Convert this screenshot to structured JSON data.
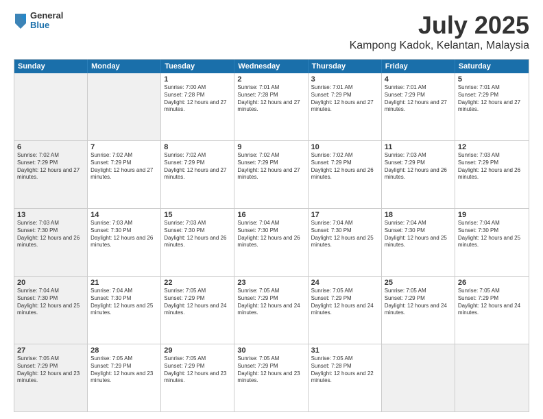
{
  "logo": {
    "general": "General",
    "blue": "Blue"
  },
  "title": "July 2025",
  "subtitle": "Kampong Kadok, Kelantan, Malaysia",
  "header_days": [
    "Sunday",
    "Monday",
    "Tuesday",
    "Wednesday",
    "Thursday",
    "Friday",
    "Saturday"
  ],
  "rows": [
    [
      {
        "day": "",
        "text": "",
        "shaded": true
      },
      {
        "day": "",
        "text": "",
        "shaded": true
      },
      {
        "day": "1",
        "text": "Sunrise: 7:00 AM\nSunset: 7:28 PM\nDaylight: 12 hours and 27 minutes.",
        "shaded": false
      },
      {
        "day": "2",
        "text": "Sunrise: 7:01 AM\nSunset: 7:28 PM\nDaylight: 12 hours and 27 minutes.",
        "shaded": false
      },
      {
        "day": "3",
        "text": "Sunrise: 7:01 AM\nSunset: 7:29 PM\nDaylight: 12 hours and 27 minutes.",
        "shaded": false
      },
      {
        "day": "4",
        "text": "Sunrise: 7:01 AM\nSunset: 7:29 PM\nDaylight: 12 hours and 27 minutes.",
        "shaded": false
      },
      {
        "day": "5",
        "text": "Sunrise: 7:01 AM\nSunset: 7:29 PM\nDaylight: 12 hours and 27 minutes.",
        "shaded": false
      }
    ],
    [
      {
        "day": "6",
        "text": "Sunrise: 7:02 AM\nSunset: 7:29 PM\nDaylight: 12 hours and 27 minutes.",
        "shaded": true
      },
      {
        "day": "7",
        "text": "Sunrise: 7:02 AM\nSunset: 7:29 PM\nDaylight: 12 hours and 27 minutes.",
        "shaded": false
      },
      {
        "day": "8",
        "text": "Sunrise: 7:02 AM\nSunset: 7:29 PM\nDaylight: 12 hours and 27 minutes.",
        "shaded": false
      },
      {
        "day": "9",
        "text": "Sunrise: 7:02 AM\nSunset: 7:29 PM\nDaylight: 12 hours and 27 minutes.",
        "shaded": false
      },
      {
        "day": "10",
        "text": "Sunrise: 7:02 AM\nSunset: 7:29 PM\nDaylight: 12 hours and 26 minutes.",
        "shaded": false
      },
      {
        "day": "11",
        "text": "Sunrise: 7:03 AM\nSunset: 7:29 PM\nDaylight: 12 hours and 26 minutes.",
        "shaded": false
      },
      {
        "day": "12",
        "text": "Sunrise: 7:03 AM\nSunset: 7:29 PM\nDaylight: 12 hours and 26 minutes.",
        "shaded": false
      }
    ],
    [
      {
        "day": "13",
        "text": "Sunrise: 7:03 AM\nSunset: 7:30 PM\nDaylight: 12 hours and 26 minutes.",
        "shaded": true
      },
      {
        "day": "14",
        "text": "Sunrise: 7:03 AM\nSunset: 7:30 PM\nDaylight: 12 hours and 26 minutes.",
        "shaded": false
      },
      {
        "day": "15",
        "text": "Sunrise: 7:03 AM\nSunset: 7:30 PM\nDaylight: 12 hours and 26 minutes.",
        "shaded": false
      },
      {
        "day": "16",
        "text": "Sunrise: 7:04 AM\nSunset: 7:30 PM\nDaylight: 12 hours and 26 minutes.",
        "shaded": false
      },
      {
        "day": "17",
        "text": "Sunrise: 7:04 AM\nSunset: 7:30 PM\nDaylight: 12 hours and 25 minutes.",
        "shaded": false
      },
      {
        "day": "18",
        "text": "Sunrise: 7:04 AM\nSunset: 7:30 PM\nDaylight: 12 hours and 25 minutes.",
        "shaded": false
      },
      {
        "day": "19",
        "text": "Sunrise: 7:04 AM\nSunset: 7:30 PM\nDaylight: 12 hours and 25 minutes.",
        "shaded": false
      }
    ],
    [
      {
        "day": "20",
        "text": "Sunrise: 7:04 AM\nSunset: 7:30 PM\nDaylight: 12 hours and 25 minutes.",
        "shaded": true
      },
      {
        "day": "21",
        "text": "Sunrise: 7:04 AM\nSunset: 7:30 PM\nDaylight: 12 hours and 25 minutes.",
        "shaded": false
      },
      {
        "day": "22",
        "text": "Sunrise: 7:05 AM\nSunset: 7:29 PM\nDaylight: 12 hours and 24 minutes.",
        "shaded": false
      },
      {
        "day": "23",
        "text": "Sunrise: 7:05 AM\nSunset: 7:29 PM\nDaylight: 12 hours and 24 minutes.",
        "shaded": false
      },
      {
        "day": "24",
        "text": "Sunrise: 7:05 AM\nSunset: 7:29 PM\nDaylight: 12 hours and 24 minutes.",
        "shaded": false
      },
      {
        "day": "25",
        "text": "Sunrise: 7:05 AM\nSunset: 7:29 PM\nDaylight: 12 hours and 24 minutes.",
        "shaded": false
      },
      {
        "day": "26",
        "text": "Sunrise: 7:05 AM\nSunset: 7:29 PM\nDaylight: 12 hours and 24 minutes.",
        "shaded": false
      }
    ],
    [
      {
        "day": "27",
        "text": "Sunrise: 7:05 AM\nSunset: 7:29 PM\nDaylight: 12 hours and 23 minutes.",
        "shaded": true
      },
      {
        "day": "28",
        "text": "Sunrise: 7:05 AM\nSunset: 7:29 PM\nDaylight: 12 hours and 23 minutes.",
        "shaded": false
      },
      {
        "day": "29",
        "text": "Sunrise: 7:05 AM\nSunset: 7:29 PM\nDaylight: 12 hours and 23 minutes.",
        "shaded": false
      },
      {
        "day": "30",
        "text": "Sunrise: 7:05 AM\nSunset: 7:29 PM\nDaylight: 12 hours and 23 minutes.",
        "shaded": false
      },
      {
        "day": "31",
        "text": "Sunrise: 7:05 AM\nSunset: 7:28 PM\nDaylight: 12 hours and 22 minutes.",
        "shaded": false
      },
      {
        "day": "",
        "text": "",
        "shaded": true
      },
      {
        "day": "",
        "text": "",
        "shaded": true
      }
    ]
  ]
}
